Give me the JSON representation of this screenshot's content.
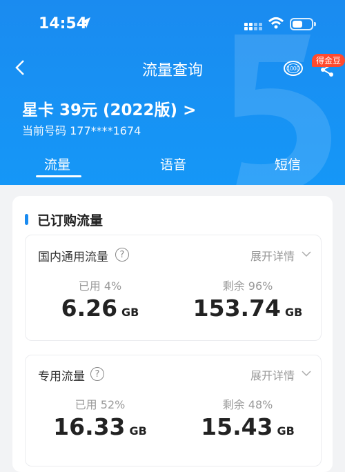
{
  "status": {
    "time": "14:54"
  },
  "nav": {
    "title": "流量查询",
    "coin_label": "1000",
    "bean_badge": "得金豆"
  },
  "plan": {
    "name": "星卡 39元 (2022版)",
    "chevron": ">",
    "number": "当前号码 177****1674"
  },
  "tabs": [
    {
      "label": "流量"
    },
    {
      "label": "语音"
    },
    {
      "label": "短信"
    }
  ],
  "section": {
    "title": "已订购流量"
  },
  "cards": [
    {
      "title": "国内通用流量",
      "help": "?",
      "expand": "展开详情",
      "used_label": "已用 4%",
      "used_value": "6.26",
      "used_unit": "GB",
      "remain_label": "剩余 96%",
      "remain_value": "153.74",
      "remain_unit": "GB"
    },
    {
      "title": "专用流量",
      "help": "?",
      "expand": "展开详情",
      "used_label": "已用 52%",
      "used_value": "16.33",
      "used_unit": "GB",
      "remain_label": "剩余 48%",
      "remain_value": "15.43",
      "remain_unit": "GB"
    }
  ],
  "colors": {
    "header": "#1a8bf0",
    "accent": "#1a8bf0",
    "badge": "#ff4a2e"
  },
  "icons": [
    "back-arrow-icon",
    "location-arrow-icon",
    "signal-icon",
    "wifi-icon",
    "battery-icon",
    "coin-icon",
    "share-icon",
    "question-icon",
    "chevron-down-icon"
  ]
}
